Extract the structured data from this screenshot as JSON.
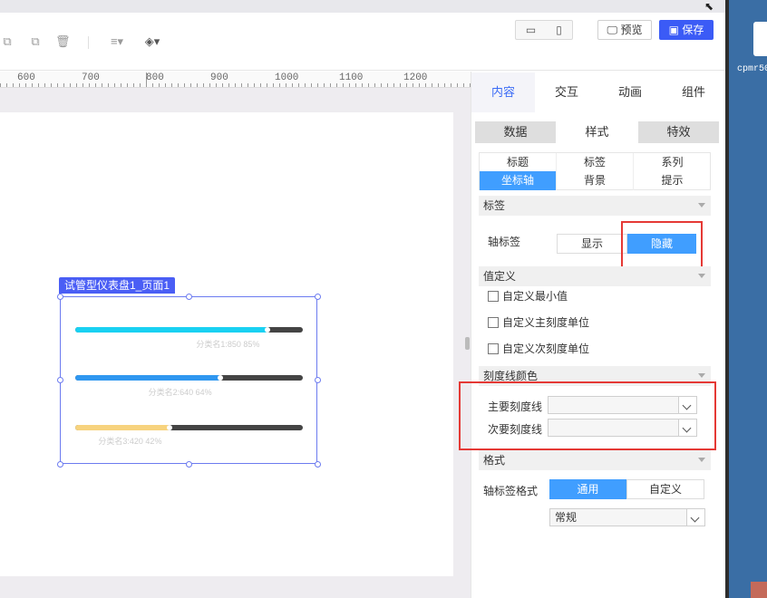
{
  "toolbar": {
    "icons": [
      "copy-icon",
      "paste-icon",
      "delete-icon",
      "align-icon",
      "layers-icon"
    ],
    "device_icons": [
      "desktop-icon",
      "mobile-icon"
    ],
    "preview_label": "预览",
    "save_label": "保存"
  },
  "ruler": {
    "labels": [
      "600",
      "700",
      "800",
      "900",
      "1000",
      "1100",
      "1200"
    ]
  },
  "widget": {
    "tag": "试管型仪表盘1_页面1",
    "bars": [
      {
        "label": "分类名1:850 85%",
        "value": 850,
        "percent": 0.85,
        "color": "#1ad1f2"
      },
      {
        "label": "分类名2:640 64%",
        "value": 640,
        "percent": 0.64,
        "color": "#2f97f0"
      },
      {
        "label": "分类名3:420 42%",
        "value": 420,
        "percent": 0.42,
        "color": "#f7d37e"
      }
    ]
  },
  "panel": {
    "main_tabs": [
      "内容",
      "交互",
      "动画",
      "组件"
    ],
    "sub_tabs": [
      "数据",
      "样式",
      "特效"
    ],
    "grid": [
      "标题",
      "标签",
      "系列",
      "坐标轴",
      "背景",
      "提示"
    ],
    "sections": {
      "label": "标签",
      "value_def": "值定义",
      "tick_color": "刻度线颜色",
      "format": "格式"
    },
    "axis_label": {
      "label": "轴标签",
      "show": "显示",
      "hide": "隐藏"
    },
    "checkboxes": [
      "自定义最小值",
      "自定义主刻度单位",
      "自定义次刻度单位"
    ],
    "tick_color": {
      "major_label": "主要刻度线",
      "minor_label": "次要刻度线"
    },
    "format": {
      "label": "轴标签格式",
      "general": "通用",
      "custom": "自定义",
      "select_value": "常规"
    }
  },
  "desktop": {
    "icon_label": "cpmr50"
  }
}
